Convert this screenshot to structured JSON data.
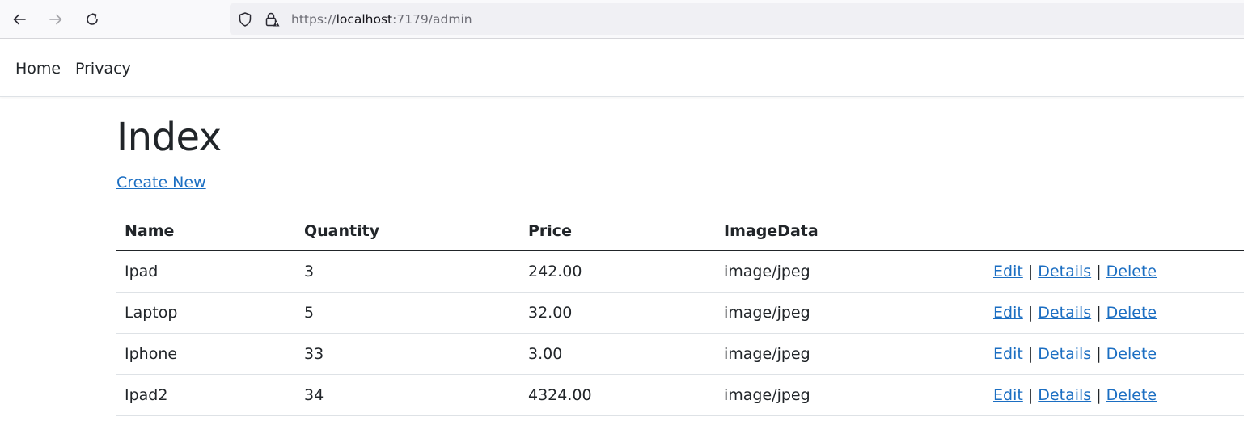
{
  "browser": {
    "url_prefix": "https://",
    "url_host": "localhost",
    "url_rest": ":7179/admin",
    "icons": [
      "back-arrow-icon",
      "forward-arrow-icon",
      "reload-icon",
      "shield-icon",
      "lock-icon"
    ]
  },
  "nav": {
    "home": "Home",
    "privacy": "Privacy"
  },
  "page": {
    "title": "Index",
    "create_new": "Create New"
  },
  "table": {
    "headers": [
      "Name",
      "Quantity",
      "Price",
      "ImageData"
    ],
    "rows": [
      {
        "name": "Ipad",
        "quantity": "3",
        "price": "242.00",
        "image_data": "image/jpeg"
      },
      {
        "name": "Laptop",
        "quantity": "5",
        "price": "32.00",
        "image_data": "image/jpeg"
      },
      {
        "name": "Iphone",
        "quantity": "33",
        "price": "3.00",
        "image_data": "image/jpeg"
      },
      {
        "name": "Ipad2",
        "quantity": "34",
        "price": "4324.00",
        "image_data": "image/jpeg"
      }
    ],
    "actions": {
      "edit": "Edit",
      "details": "Details",
      "delete": "Delete",
      "separator": "|"
    }
  },
  "colors": {
    "link": "#1b6ec2",
    "text": "#212529",
    "browser_bg": "#f9f9fb",
    "urlbar_bg": "#f0f0f4"
  }
}
